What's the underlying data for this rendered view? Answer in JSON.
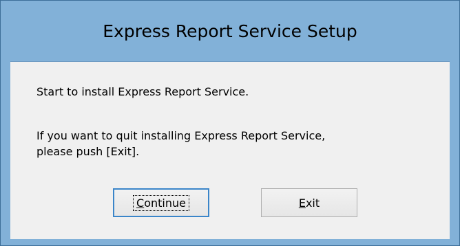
{
  "window": {
    "title": "Express Report Service Setup"
  },
  "messages": {
    "line1": "Start to install Express Report Service.",
    "line2": "If you want to quit installing Express Report Service,",
    "line3": "please push [Exit]."
  },
  "buttons": {
    "continue_mnemonic": "C",
    "continue_rest": "ontinue",
    "exit_mnemonic": "E",
    "exit_rest": "xit"
  }
}
